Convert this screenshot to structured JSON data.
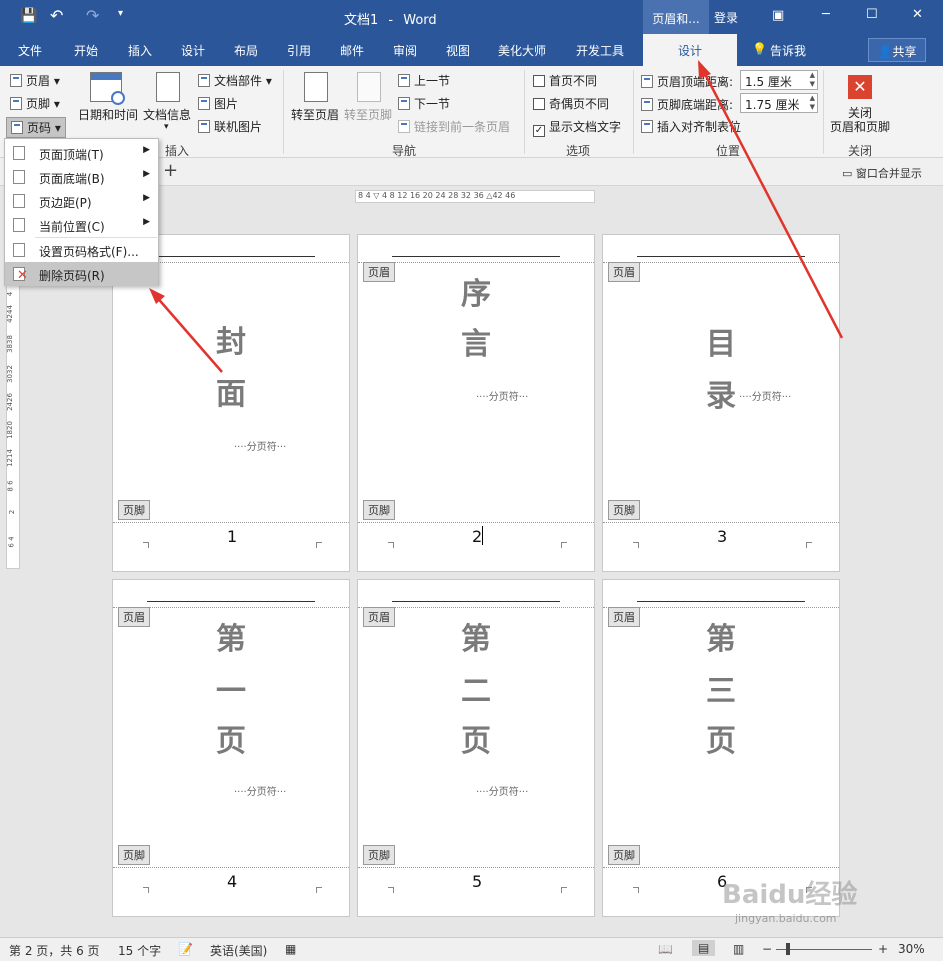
{
  "titlebar": {
    "document_title": "文档1",
    "separator": "-",
    "app_name": "Word",
    "contextual_tab": "页眉和...",
    "login": "登录",
    "quick_access": {
      "save": "save-icon",
      "undo": "undo-icon",
      "redo": "redo-icon",
      "customize": "▾"
    },
    "window_controls": {
      "ribbon_options": "ribbon-options-icon",
      "minimize": "─",
      "maximize": "☐",
      "close": "✕"
    }
  },
  "tabs": [
    "文件",
    "开始",
    "插入",
    "设计",
    "布局",
    "引用",
    "邮件",
    "审阅",
    "视图",
    "美化大师",
    "开发工具",
    "设计"
  ],
  "tell_me": "告诉我",
  "share": "共享",
  "ribbon": {
    "header_btn": "页眉",
    "footer_btn": "页脚",
    "page_number_btn": "页码",
    "date_time": "日期和时间",
    "doc_info": "文档信息",
    "doc_parts": "文档部件",
    "picture": "图片",
    "online_picture": "联机图片",
    "group_insert": "插入",
    "goto_header": "转至页眉",
    "goto_footer": "转至页脚",
    "prev_section": "上一节",
    "next_section": "下一节",
    "link_previous": "链接到前一条页眉",
    "group_nav": "导航",
    "first_page_diff": "首页不同",
    "odd_even_diff": "奇偶页不同",
    "show_doc_text": "显示文档文字",
    "show_doc_text_checked": "✓",
    "group_options": "选项",
    "header_top_label": "页眉顶端距离:",
    "header_top_value": "1.5 厘米",
    "footer_bottom_label": "页脚底端距离:",
    "footer_bottom_value": "1.75 厘米",
    "insert_align_tab": "插入对齐制表位",
    "group_position": "位置",
    "close_line1": "关闭",
    "close_line2": "页眉和页脚",
    "group_close": "关闭"
  },
  "menu": [
    {
      "label": "页面顶端(T)",
      "sub": "▶"
    },
    {
      "label": "页面底端(B)",
      "sub": "▶"
    },
    {
      "label": "页边距(P)",
      "sub": "▶"
    },
    {
      "label": "当前位置(C)",
      "sub": "▶"
    },
    {
      "label": "设置页码格式(F)...",
      "sub": ""
    },
    {
      "label": "删除页码(R)",
      "sub": ""
    }
  ],
  "docbar": {
    "add_tab": "+",
    "merge_windows": "窗口合并显示"
  },
  "ruler": {
    "h_ticks": "8  4  ▽  4  8  12  16  20  24  28  32  36  △42  46",
    "v_ticks": [
      "4",
      "4244",
      "3838",
      "3032",
      "2426",
      "1820",
      "1214",
      "8 6",
      "2",
      "6 4"
    ]
  },
  "labels": {
    "header": "页眉",
    "footer": "页脚",
    "page_break": "分页符"
  },
  "pages": [
    {
      "chars": [
        "封",
        "面"
      ],
      "number": "1"
    },
    {
      "chars": [
        "序",
        "言"
      ],
      "number": "2"
    },
    {
      "chars": [
        "目",
        "录"
      ],
      "number": "3"
    },
    {
      "chars": [
        "第",
        "一",
        "页"
      ],
      "number": "4"
    },
    {
      "chars": [
        "第",
        "二",
        "页"
      ],
      "number": "5"
    },
    {
      "chars": [
        "第",
        "三",
        "页"
      ],
      "number": "6"
    }
  ],
  "status": {
    "page": "第 2 页，共 6 页",
    "words": "15 个字",
    "language": "英语(美国)",
    "zoom": "30%",
    "minus": "−",
    "plus": "+"
  },
  "watermark": "Baidu经验",
  "watermark_url": "jingyan.baidu.com",
  "colors": {
    "accent": "#2b579a",
    "arrow": "#e0342d"
  }
}
